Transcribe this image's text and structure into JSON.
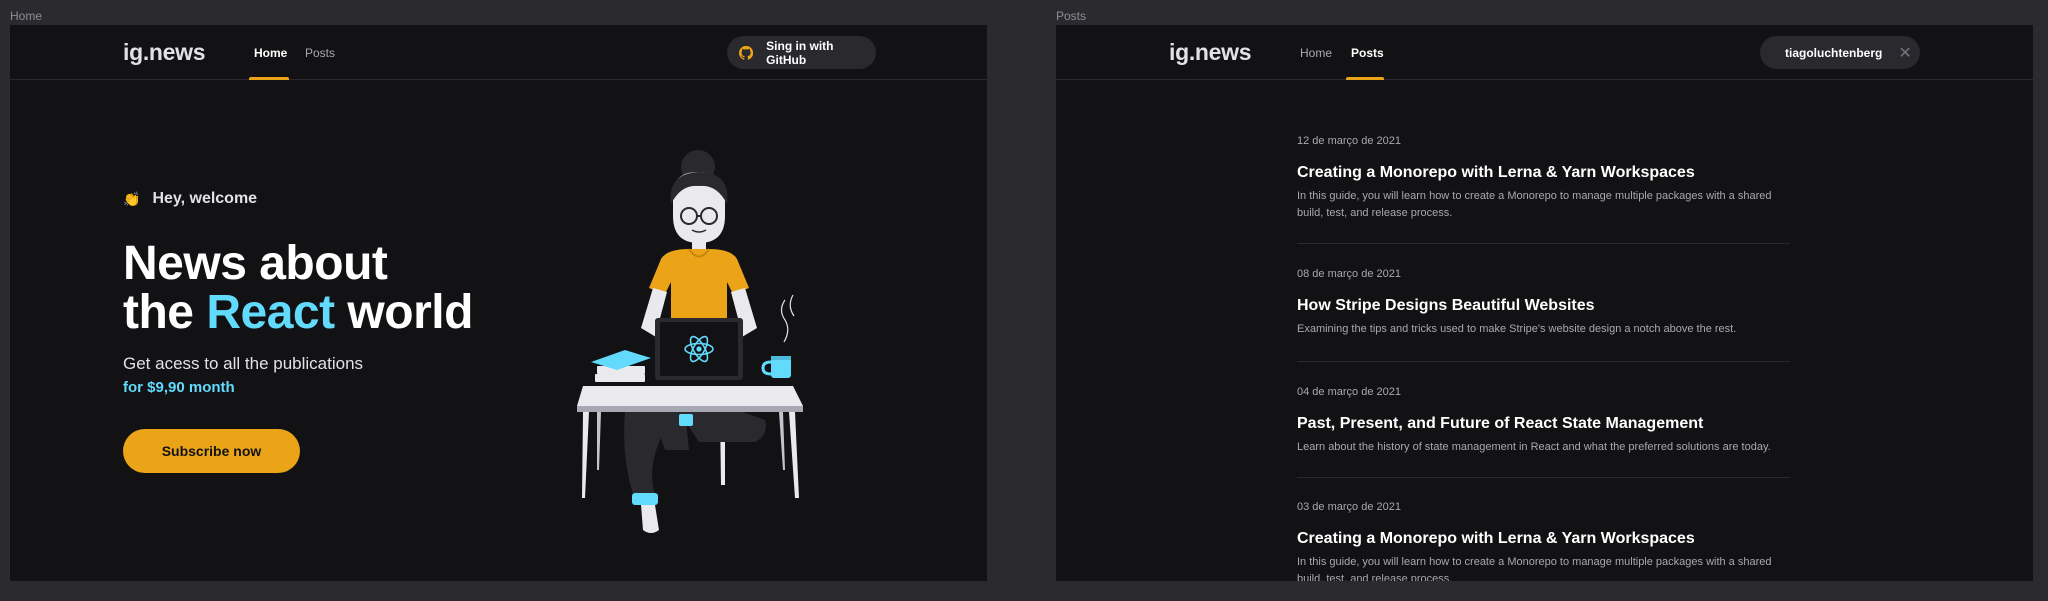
{
  "frames": {
    "home_label": "Home",
    "posts_label": "Posts"
  },
  "header": {
    "logo": "ig.news",
    "nav_home": "Home",
    "nav_posts": "Posts",
    "signin_label": "Sing in with GitHub",
    "username": "tiagoluchtenberg",
    "close_glyph": "✕"
  },
  "hero": {
    "welcome_emoji": "👏",
    "welcome_text": "Hey, welcome",
    "headline_line1": "News about",
    "headline_the": "the",
    "headline_react": "React",
    "headline_world": "world",
    "subtitle": "Get acess to all the publications",
    "price": "for $9,90 month",
    "subscribe_label": "Subscribe now"
  },
  "colors": {
    "accent_yellow": "#eba417",
    "accent_cyan": "#61dafb",
    "github_orange": "#eba417",
    "github_green": "#04d361",
    "background": "#121214"
  },
  "posts": [
    {
      "date": "12 de março de 2021",
      "title": "Creating a Monorepo with Lerna & Yarn Workspaces",
      "excerpt": "In this guide, you will learn how to create a Monorepo to manage multiple packages with a shared build, test, and release process."
    },
    {
      "date": "08 de março de 2021",
      "title": "How Stripe Designs Beautiful Websites",
      "excerpt": "Examining the tips and tricks used to make Stripe's website design a notch above the rest."
    },
    {
      "date": "04 de março de 2021",
      "title": "Past, Present, and Future of React State Management",
      "excerpt": "Learn about the history of state management in React and what the preferred solutions are today."
    },
    {
      "date": "03 de março de 2021",
      "title": "Creating a Monorepo with Lerna & Yarn Workspaces",
      "excerpt": "In this guide, you will learn how to create a Monorepo to manage multiple packages with a shared build, test, and release process."
    }
  ]
}
